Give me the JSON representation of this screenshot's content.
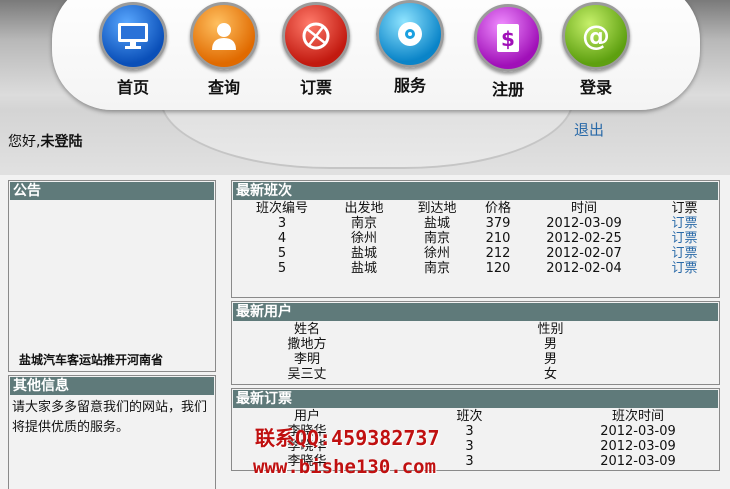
{
  "nav": [
    {
      "label": "首页",
      "icon": "monitor-icon",
      "color": "#1e6fd0"
    },
    {
      "label": "查询",
      "icon": "user-icon",
      "color": "#f08a14"
    },
    {
      "label": "订票",
      "icon": "ball-icon",
      "color": "#d8281a"
    },
    {
      "label": "服务",
      "icon": "cd-icon",
      "color": "#1aa0e0"
    },
    {
      "label": "注册",
      "icon": "dollar-icon",
      "color": "#c830d8"
    },
    {
      "label": "登录",
      "icon": "at-icon",
      "color": "#7cc21a"
    }
  ],
  "greeting": {
    "prefix": "您好,",
    "status": "未登陆"
  },
  "logout_label": "退出",
  "notice": {
    "title": "公告",
    "text": "盐城汽车客运站推开河南省"
  },
  "other_info": {
    "title": "其他信息",
    "text": "请大家多多留意我们的网站，我们将提供优质的服务。"
  },
  "latest_trips": {
    "title": "最新班次",
    "headers": [
      "班次编号",
      "出发地",
      "到达地",
      "价格",
      "时间",
      "订票"
    ],
    "rows": [
      {
        "id": "3",
        "from": "南京",
        "to": "盐城",
        "price": "379",
        "date": "2012-03-09",
        "action": "订票"
      },
      {
        "id": "4",
        "from": "徐州",
        "to": "南京",
        "price": "210",
        "date": "2012-02-25",
        "action": "订票"
      },
      {
        "id": "5",
        "from": "盐城",
        "to": "徐州",
        "price": "212",
        "date": "2012-02-07",
        "action": "订票"
      },
      {
        "id": "5",
        "from": "盐城",
        "to": "南京",
        "price": "120",
        "date": "2012-02-04",
        "action": "订票"
      }
    ]
  },
  "latest_users": {
    "title": "最新用户",
    "headers": [
      "姓名",
      "性别"
    ],
    "rows": [
      {
        "name": "撒地方",
        "gender": "男"
      },
      {
        "name": "李明",
        "gender": "男"
      },
      {
        "name": "吴三丈",
        "gender": "女"
      }
    ]
  },
  "latest_orders": {
    "title": "最新订票",
    "headers": [
      "用户",
      "班次",
      "班次时间"
    ],
    "rows": [
      {
        "user": "李晓华",
        "trip": "3",
        "date": "2012-03-09"
      },
      {
        "user": "李晓华",
        "trip": "3",
        "date": "2012-03-09"
      },
      {
        "user": "李晓华",
        "trip": "3",
        "date": "2012-03-09"
      }
    ]
  },
  "watermark": {
    "contact": "联系QQ:459382737",
    "site": "www.bishe130.com"
  },
  "colors": {
    "panel_header": "#5f7a7a",
    "link": "#2a6aa8",
    "watermark": "#c01010"
  }
}
